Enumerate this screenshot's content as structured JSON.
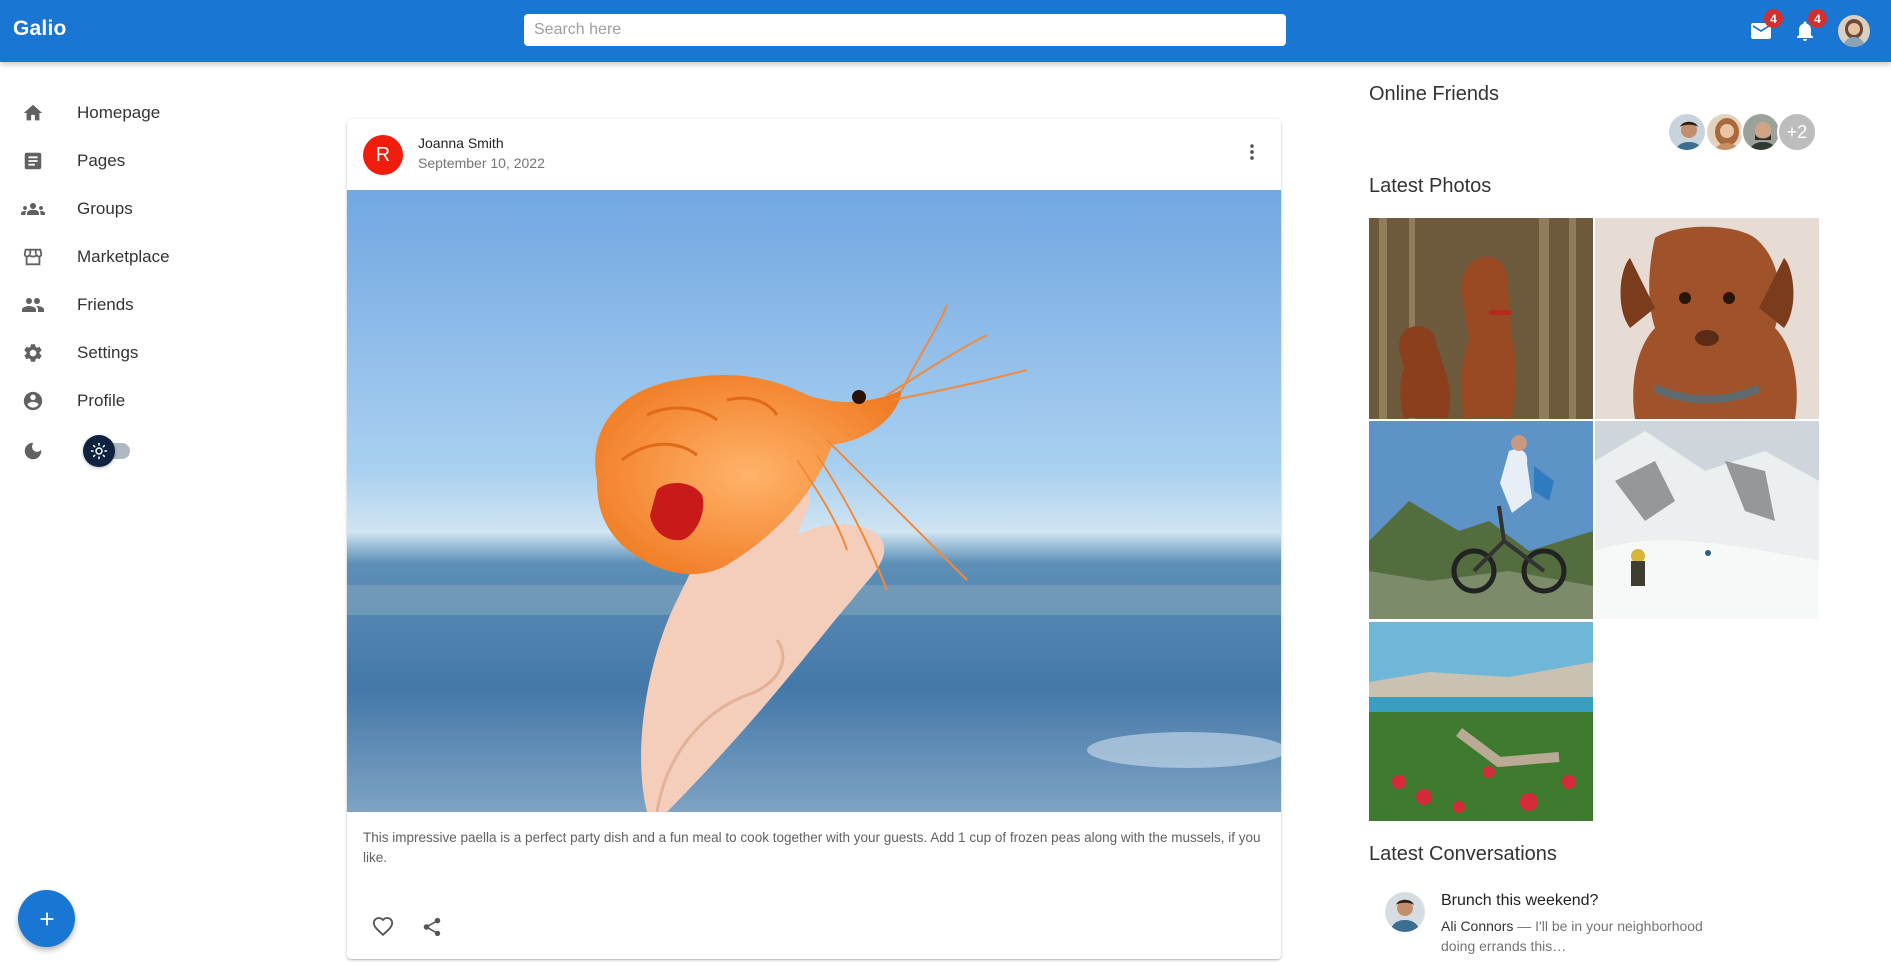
{
  "header": {
    "brand": "Galio",
    "search_placeholder": "Search here",
    "mail_badge": "4",
    "notifications_badge": "4",
    "colors": {
      "appbar": "#1976d2",
      "badge": "#d32f2f"
    }
  },
  "sidebar": {
    "items": [
      {
        "label": "Homepage",
        "icon": "home-icon"
      },
      {
        "label": "Pages",
        "icon": "article-icon"
      },
      {
        "label": "Groups",
        "icon": "groups-icon"
      },
      {
        "label": "Marketplace",
        "icon": "storefront-icon"
      },
      {
        "label": "Friends",
        "icon": "people-icon"
      },
      {
        "label": "Settings",
        "icon": "gear-icon"
      },
      {
        "label": "Profile",
        "icon": "account-circle-icon"
      }
    ],
    "theme_toggle": {
      "icon": "moon-icon",
      "thumb_icon": "sun-icon",
      "state": "light"
    },
    "fab": {
      "label": "+",
      "icon": "plus-icon"
    }
  },
  "post": {
    "avatar_letter": "R",
    "author": "Joanna Smith",
    "date": "September 10, 2022",
    "image_alt": "Hand holding a cooked shrimp over the sea",
    "text": "This impressive paella is a perfect party dish and a fun meal to cook together with your guests. Add 1 cup of frozen peas along with the mussels, if you like.",
    "avatar_color": "#f21c0d"
  },
  "right": {
    "online_friends_title": "Online Friends",
    "online_friends_more": "+2",
    "latest_photos_title": "Latest Photos",
    "photos": [
      {
        "alt": "Two brown dogs in a forest"
      },
      {
        "alt": "Brown dog portrait"
      },
      {
        "alt": "Cyclist on a mountain"
      },
      {
        "alt": "Hiker on a snowy mountain"
      },
      {
        "alt": "Garden with flowers by the coast"
      }
    ],
    "latest_conversations_title": "Latest Conversations",
    "conversation": {
      "title": "Brunch this weekend?",
      "author": "Ali Connors",
      "preview": " — I'll be in your neighborhood doing errands this…"
    }
  }
}
